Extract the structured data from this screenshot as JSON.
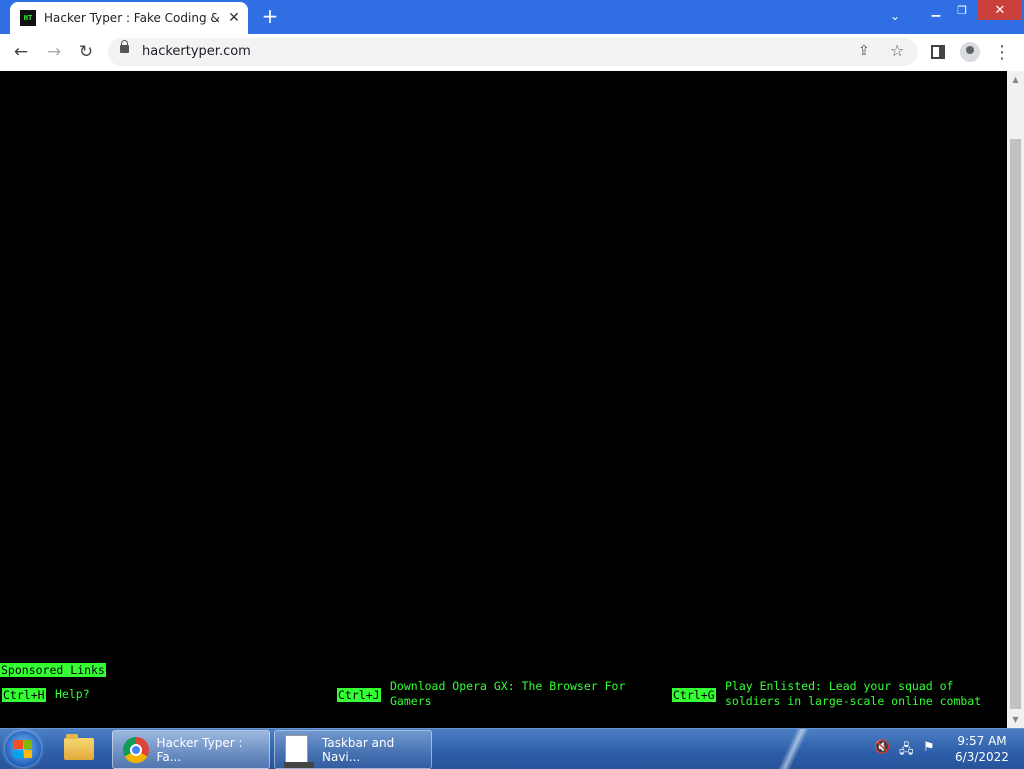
{
  "browser": {
    "tab_favicon_text": "HT",
    "tab_title": "Hacker Typer : Fake Coding & Hacker Simulator",
    "tab_close": "✕",
    "new_tab": "+",
    "tabs_dropdown": "⌄",
    "window_minimize": "▁",
    "window_restore": "❐",
    "window_close": "✕",
    "back": "←",
    "forward": "→",
    "reload": "↻",
    "url": "hackertyper.com",
    "share_icon": "⇪",
    "star_icon": "☆",
    "menu_icon": "⋮"
  },
  "page": {
    "sponsored_label": "Sponsored Links",
    "links": [
      {
        "key": "Ctrl+H",
        "text": "Help?"
      },
      {
        "key": "Ctrl+J",
        "text_line1": "Download Opera GX: The Browser For",
        "text_line2": "Gamers"
      },
      {
        "key": "Ctrl+G",
        "text_line1": "Play Enlisted: Lead your squad of",
        "text_line2": "soldiers in large-scale online combat"
      }
    ]
  },
  "taskbar": {
    "tasks": [
      {
        "label": "Hacker Typer : Fa..."
      },
      {
        "label": "Taskbar and Navi..."
      }
    ],
    "clock_time": "9:57 AM",
    "clock_date": "6/3/2022"
  }
}
